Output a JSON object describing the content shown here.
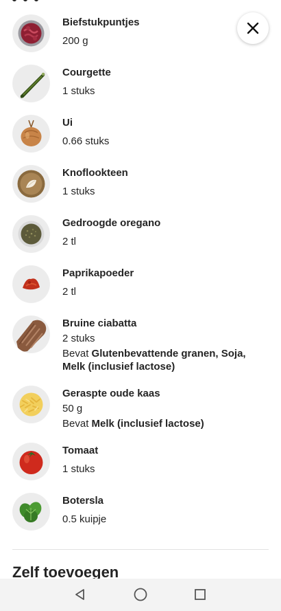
{
  "ingredients": [
    {
      "name": "Biefstukpuntjes",
      "quantity": "200 g",
      "icon": "beef-strips-icon"
    },
    {
      "name": "Courgette",
      "quantity": "1 stuks",
      "icon": "zucchini-icon"
    },
    {
      "name": "Ui",
      "quantity": "0.66 stuks",
      "icon": "onion-icon"
    },
    {
      "name": "Knoflookteen",
      "quantity": "1 stuks",
      "icon": "garlic-icon"
    },
    {
      "name": "Gedroogde oregano",
      "quantity": "2 tl",
      "icon": "oregano-icon"
    },
    {
      "name": "Paprikapoeder",
      "quantity": "2 tl",
      "icon": "paprika-icon"
    },
    {
      "name": "Bruine ciabatta",
      "quantity": "2 stuks",
      "allergen_prefix": "Bevat",
      "allergens": "Glutenbevattende granen, Soja, Melk (inclusief lactose)",
      "icon": "ciabatta-icon"
    },
    {
      "name": "Geraspte oude kaas",
      "quantity": "50 g",
      "allergen_prefix": "Bevat",
      "allergens": "Melk (inclusief lactose)",
      "icon": "cheese-icon"
    },
    {
      "name": "Tomaat",
      "quantity": "1 stuks",
      "icon": "tomato-icon"
    },
    {
      "name": "Botersla",
      "quantity": "0.5 kuipje",
      "icon": "lettuce-icon"
    }
  ],
  "section_title": "Zelf toevoegen",
  "close_button": {
    "icon": "close-icon"
  },
  "navbar": {
    "back_icon": "back-triangle-icon",
    "home_icon": "home-circle-icon",
    "recents_icon": "recents-square-icon"
  },
  "colors": {
    "background": "#ffffff",
    "text": "#242424",
    "thumb_bg": "#efefef",
    "navbar_bg": "#f3f3f3"
  }
}
